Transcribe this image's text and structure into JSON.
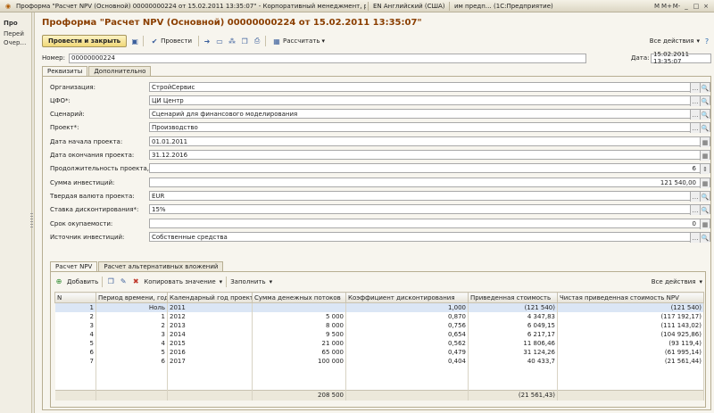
{
  "titlebar": {
    "title": "Проформа \"Расчет NPV (Основной)  00000000224 от 15.02.2011 13:35:07\" - Корпоративный менеджмент, редакция 7.0 + ПБ",
    "lang": "EN Английский (США)",
    "app": "им предп… (1С:Предприятие)",
    "buttons": [
      "M",
      "M+",
      "M-",
      "_",
      "□",
      "×"
    ]
  },
  "leftpanel": {
    "title": "Про",
    "items": [
      "Перей",
      "Очер…"
    ]
  },
  "window": {
    "title": "Проформа \"Расчет NPV (Основной)  00000000224 от 15.02.2011 13:35:07\""
  },
  "toolbar": {
    "post_close": "Провести и закрыть",
    "post": "Провести",
    "calculate": "Рассчитать",
    "all_actions": "Все действия"
  },
  "header": {
    "number_label": "Номер:",
    "number_value": "00000000224",
    "date_label": "Дата:",
    "date_value": "15.02.2011 13:35:07"
  },
  "tabs1": [
    "Реквизиты",
    "Дополнительно"
  ],
  "fields": [
    {
      "label": "Организация:",
      "value": "СтройСервис",
      "align": "left",
      "buttons": [
        "…",
        "🔍"
      ]
    },
    {
      "label": "ЦФО*:",
      "value": "ЦИ Центр",
      "align": "left",
      "buttons": [
        "…",
        "🔍"
      ]
    },
    {
      "label": "Сценарий:",
      "value": "Сценарий для финансового моделирования",
      "align": "left",
      "buttons": [
        "…",
        "🔍"
      ]
    },
    {
      "label": "Проект*:",
      "value": "Производство",
      "align": "left",
      "buttons": [
        "…",
        "🔍"
      ]
    },
    {
      "label": "Дата начала проекта:",
      "value": "01.01.2011",
      "align": "left",
      "buttons": [
        "▦"
      ]
    },
    {
      "label": "Дата окончания проекта:",
      "value": "31.12.2016",
      "align": "left",
      "buttons": [
        "▦"
      ]
    },
    {
      "label": "Продолжительность проекта, лет:",
      "value": "6",
      "align": "right",
      "buttons": [
        "⇕"
      ]
    },
    {
      "label": "Сумма инвестиций:",
      "value": "121 540,00",
      "align": "right",
      "buttons": [
        "▦"
      ]
    },
    {
      "label": "Твердая валюта проекта:",
      "value": "EUR",
      "align": "left",
      "buttons": [
        "…",
        "🔍"
      ]
    },
    {
      "label": "Ставка дисконтирования*:",
      "value": "15%",
      "align": "left",
      "buttons": [
        "…",
        "🔍"
      ]
    },
    {
      "label": "Срок окупаемости:",
      "value": "0",
      "align": "right",
      "buttons": [
        "▦"
      ]
    },
    {
      "label": "Источник инвестиций:",
      "value": "Собственные средства",
      "align": "left",
      "buttons": [
        "…",
        "🔍"
      ]
    }
  ],
  "tabs2": [
    "Расчет NPV",
    "Расчет альтернативных вложений"
  ],
  "table_toolbar": {
    "add": "Добавить",
    "copy_value": "Копировать значение",
    "fill": "Заполнить",
    "all_actions": "Все действия"
  },
  "table": {
    "columns": [
      "N",
      "Период времени, год",
      "Календарный год проекта",
      "Сумма денежных потоков",
      "Коэффициент дисконтирования",
      "Приведенная стоимость",
      "Чистая приведенная стоимость NPV"
    ],
    "rows": [
      [
        "1",
        "Ноль",
        "2011",
        "",
        "1,000",
        "(121 540)",
        "(121 540)"
      ],
      [
        "2",
        "1",
        "2012",
        "5 000",
        "0,870",
        "4 347,83",
        "(117 192,17)"
      ],
      [
        "3",
        "2",
        "2013",
        "8 000",
        "0,756",
        "6 049,15",
        "(111 143,02)"
      ],
      [
        "4",
        "3",
        "2014",
        "9 500",
        "0,654",
        "6 217,17",
        "(104 925,86)"
      ],
      [
        "5",
        "4",
        "2015",
        "21 000",
        "0,562",
        "11 806,46",
        "(93 119,4)"
      ],
      [
        "6",
        "5",
        "2016",
        "65 000",
        "0,479",
        "31 124,26",
        "(61 995,14)"
      ],
      [
        "7",
        "6",
        "2017",
        "100 000",
        "0,404",
        "40 433,7",
        "(21 561,44)"
      ]
    ],
    "footer": [
      "",
      "",
      "",
      "208 500",
      "",
      "(21 561,43)",
      ""
    ]
  }
}
